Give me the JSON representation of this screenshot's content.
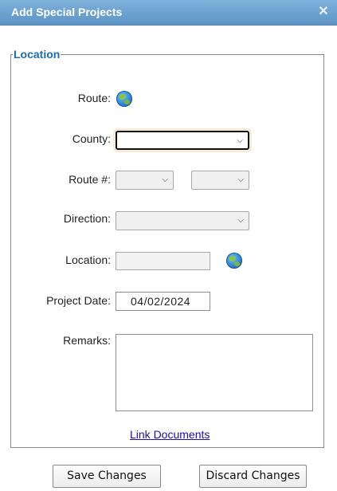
{
  "dialog": {
    "title": "Add Special Projects",
    "close_icon": "close-icon"
  },
  "location": {
    "legend": "Location",
    "route_label": "Route:",
    "county_label": "County:",
    "county_value": "",
    "route_num_label": "Route #:",
    "route_num_prefix": "",
    "route_num_value": "",
    "direction_label": "Direction:",
    "direction_value": "",
    "location_label": "Location:",
    "location_value": "",
    "project_date_label": "Project Date:",
    "project_date_value": "04/02/2024",
    "remarks_label": "Remarks:",
    "remarks_value": "",
    "link_documents": "Link Documents"
  },
  "footer": {
    "save_label": "Save Changes",
    "discard_label": "Discard Changes"
  },
  "colors": {
    "title_bar": "#6aa3d3",
    "legend": "#1b6bb5",
    "link": "#1a0dab"
  }
}
